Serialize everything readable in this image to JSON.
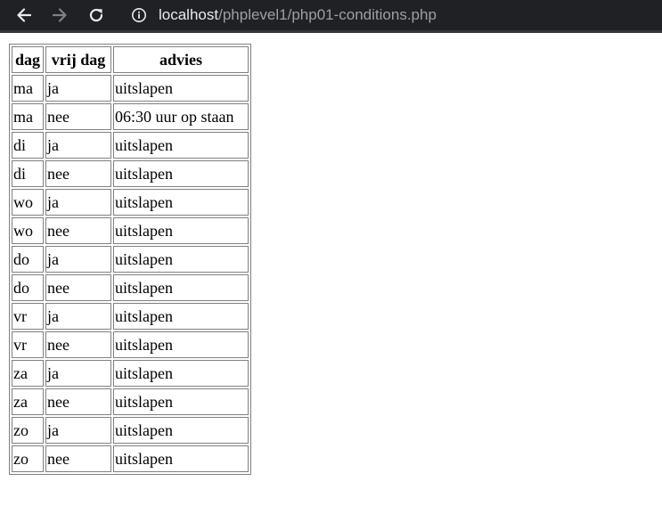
{
  "browser": {
    "url_host": "localhost",
    "url_path": "/phplevel1/php01-conditions.php",
    "icons": {
      "back": "arrow-left-icon",
      "forward": "arrow-right-icon",
      "reload": "reload-icon",
      "info": "info-circle-icon"
    },
    "colors": {
      "bar_bg": "#202124",
      "host_text": "#e8eaed",
      "path_text": "#9aa0a6",
      "forward_disabled": "#7f8185"
    }
  },
  "table": {
    "headers": [
      "dag",
      "vrij dag",
      "advies"
    ],
    "rows": [
      [
        "ma",
        "ja",
        "uitslapen"
      ],
      [
        "ma",
        "nee",
        "06:30 uur op staan"
      ],
      [
        "di",
        "ja",
        "uitslapen"
      ],
      [
        "di",
        "nee",
        "uitslapen"
      ],
      [
        "wo",
        "ja",
        "uitslapen"
      ],
      [
        "wo",
        "nee",
        "uitslapen"
      ],
      [
        "do",
        "ja",
        "uitslapen"
      ],
      [
        "do",
        "nee",
        "uitslapen"
      ],
      [
        "vr",
        "ja",
        "uitslapen"
      ],
      [
        "vr",
        "nee",
        "uitslapen"
      ],
      [
        "za",
        "ja",
        "uitslapen"
      ],
      [
        "za",
        "nee",
        "uitslapen"
      ],
      [
        "zo",
        "ja",
        "uitslapen"
      ],
      [
        "zo",
        "nee",
        "uitslapen"
      ]
    ]
  }
}
